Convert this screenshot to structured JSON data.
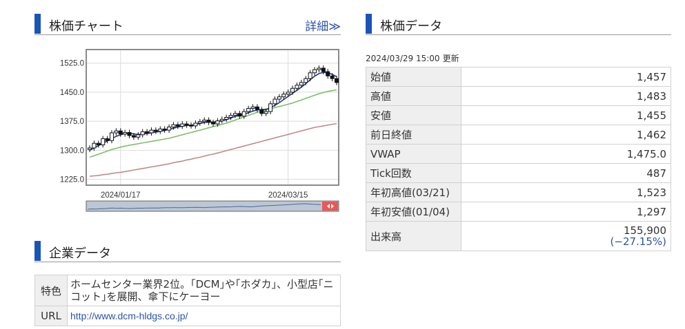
{
  "chart_section": {
    "title": "株価チャート",
    "more_link": "詳細≫"
  },
  "data_section": {
    "title": "株価データ",
    "timestamp": "2024/03/29 15:00",
    "updated_label": "更新",
    "rows": [
      {
        "label": "始値",
        "value": "1,457"
      },
      {
        "label": "高値",
        "value": "1,483"
      },
      {
        "label": "安値",
        "value": "1,455"
      },
      {
        "label": "前日終値",
        "value": "1,462"
      },
      {
        "label": "VWAP",
        "value": "1,475.0"
      },
      {
        "label": "Tick回数",
        "value": "487"
      },
      {
        "label": "年初高値(03/21)",
        "value": "1,523"
      },
      {
        "label": "年初安値(01/04)",
        "value": "1,297"
      },
      {
        "label": "出来高",
        "value": "155,900",
        "sub": "(−27.15%)"
      }
    ]
  },
  "company_section": {
    "title": "企業データ",
    "feature_label": "特色",
    "feature_text": "ホームセンター業界2位。｢DCM｣や｢ホダカ｣、小型店｢ニコット｣を展開、傘下にケーヨー",
    "url_label": "URL",
    "url_text": "http://www.dcm-hldgs.co.jp/"
  },
  "colors": {
    "accent_bar": "#1955b7",
    "link": "#2a53a8",
    "ma_short": "#1a3a8a",
    "ma_mid": "#7cbf6a",
    "ma_long": "#c08a8a"
  },
  "chart_data": {
    "type": "candlestick",
    "ylim": [
      1210,
      1560
    ],
    "yticks": [
      "1525.0",
      "1450.0",
      "1375.0",
      "1300.0",
      "1225.0"
    ],
    "ytick_values": [
      1525,
      1450,
      1375,
      1300,
      1225
    ],
    "xticks": [
      "2024/01/17",
      "2024/03/15"
    ],
    "n_sessions": 57,
    "xtick_session_index": [
      7,
      45
    ],
    "closes": [
      1306,
      1318,
      1314,
      1330,
      1325,
      1345,
      1350,
      1342,
      1346,
      1338,
      1334,
      1340,
      1348,
      1345,
      1352,
      1349,
      1355,
      1352,
      1360,
      1366,
      1362,
      1368,
      1365,
      1363,
      1370,
      1374,
      1378,
      1372,
      1368,
      1376,
      1380,
      1385,
      1390,
      1395,
      1388,
      1400,
      1408,
      1412,
      1405,
      1395,
      1400,
      1420,
      1432,
      1438,
      1445,
      1450,
      1460,
      1468,
      1475,
      1485,
      1500,
      1508,
      1512,
      1503,
      1492,
      1485,
      1475
    ],
    "ma_short": [
      1300,
      1306,
      1312,
      1318,
      1324,
      1330,
      1336,
      1340,
      1343,
      1344,
      1342,
      1341,
      1342,
      1343,
      1345,
      1347,
      1349,
      1351,
      1354,
      1357,
      1360,
      1362,
      1364,
      1365,
      1366,
      1369,
      1372,
      1373,
      1373,
      1374,
      1376,
      1379,
      1383,
      1388,
      1390,
      1393,
      1397,
      1401,
      1404,
      1405,
      1406,
      1410,
      1416,
      1423,
      1431,
      1439,
      1447,
      1455,
      1463,
      1472,
      1482,
      1491,
      1498,
      1501,
      1500,
      1496,
      1490
    ],
    "ma_mid": [
      1282,
      1286,
      1290,
      1294,
      1298,
      1302,
      1305,
      1308,
      1311,
      1313,
      1315,
      1317,
      1319,
      1321,
      1323,
      1325,
      1327,
      1329,
      1331,
      1334,
      1337,
      1340,
      1343,
      1346,
      1349,
      1352,
      1355,
      1358,
      1361,
      1364,
      1367,
      1370,
      1374,
      1378,
      1382,
      1386,
      1390,
      1394,
      1398,
      1401,
      1404,
      1407,
      1410,
      1413,
      1416,
      1419,
      1422,
      1426,
      1430,
      1434,
      1438,
      1442,
      1446,
      1449,
      1452,
      1454,
      1456
    ],
    "ma_long": [
      1233,
      1234,
      1235,
      1237,
      1238,
      1240,
      1242,
      1243,
      1245,
      1247,
      1249,
      1251,
      1253,
      1255,
      1257,
      1259,
      1261,
      1263,
      1265,
      1268,
      1270,
      1272,
      1275,
      1277,
      1280,
      1282,
      1285,
      1288,
      1290,
      1293,
      1296,
      1299,
      1302,
      1305,
      1308,
      1311,
      1314,
      1317,
      1320,
      1323,
      1326,
      1329,
      1332,
      1335,
      1338,
      1341,
      1344,
      1347,
      1350,
      1353,
      1356,
      1359,
      1361,
      1363,
      1365,
      1367,
      1369
    ]
  }
}
